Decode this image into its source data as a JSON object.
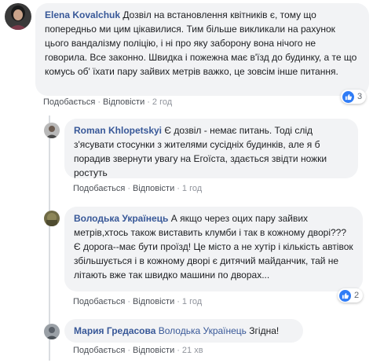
{
  "comments": [
    {
      "author": "Elena Kovalchuk",
      "text": "Дозвіл на встановлення квітників є, тому що попередньо ми цим цікавилися. Тим більше викликали на рахунок цього вандалізму поліцію, і ні про яку заборону вона нічого не говорила. Все законно. Швидка і пожежна має в'їзд до будинку, а те що комусь об' їхати пару зайвих метрів важко, це зовсім інше питання.",
      "like_label": "Подобається",
      "reply_label": "Відповісти",
      "time": "2 год",
      "reactions": "3"
    },
    {
      "author": "Roman Khlopetskyi",
      "text": "Є дозвіл - немає питань. Тоді слід з'ясувати стосунки з жителями сусідніх будинків, але я б порадив звернути увагу на Егоїста, здається звідти ножки ростуть",
      "like_label": "Подобається",
      "reply_label": "Відповісти",
      "time": "1 год"
    },
    {
      "author": "Володька Українець",
      "text": "А якщо через оцих пару зайвих метрів,хтось також виставить клумби і так в кожному дворі??? Є дорога--має бути проїзд! Це місто а не хутір і кількість автівок збільшується і в кожному дворі є дитячий майданчик, тай не літають вже так швидко машини по дворах...",
      "like_label": "Подобається",
      "reply_label": "Відповісти",
      "time": "1 год",
      "reactions": "2"
    },
    {
      "author": "Мария Гредасова",
      "mention": "Володька Українець",
      "text": "Згідна!",
      "like_label": "Подобається",
      "reply_label": "Відповісти",
      "time": "21 хв"
    }
  ],
  "colors": {
    "author": "#385898",
    "bubble": "#f2f3f5",
    "like_blue": "#2f7cf6"
  }
}
